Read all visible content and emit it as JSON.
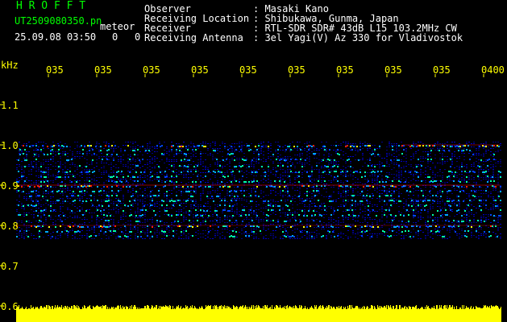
{
  "header": {
    "brand": "H R O F F T",
    "filename": "UT2509080350.pn",
    "meteor_word": "meteor",
    "datetime": "25.09.08 03:50",
    "count_left": "0",
    "count_right": "0"
  },
  "station": {
    "rows": [
      {
        "label": "Observer",
        "value": ": Masaki Kano"
      },
      {
        "label": "Receiving Location",
        "value": ": Shibukawa, Gunma, Japan"
      },
      {
        "label": "Receiver",
        "value": ": RTL-SDR SDR# 43dB L15 103.2MHz CW"
      },
      {
        "label": "Receiving Antenna",
        "value": ": 3el Yagi(V) Az 330 for Vladivostok"
      }
    ]
  },
  "axes": {
    "freq_unit": "kHz",
    "freq_labels": [
      "1.1",
      "1.0",
      "0.9",
      "0.8",
      "0.7",
      "0.6"
    ],
    "time_labels": [
      "035",
      "035",
      "035",
      "035",
      "035",
      "035",
      "035",
      "035",
      "035",
      "0400"
    ]
  },
  "colors": {
    "background": "#000000",
    "text_green": "#00ff00",
    "text_white": "#ffffff",
    "axis_yellow": "#ffff00",
    "signal_low": "#0000ff",
    "signal_mid": "#00ffff",
    "signal_high": "#ff0000"
  }
}
